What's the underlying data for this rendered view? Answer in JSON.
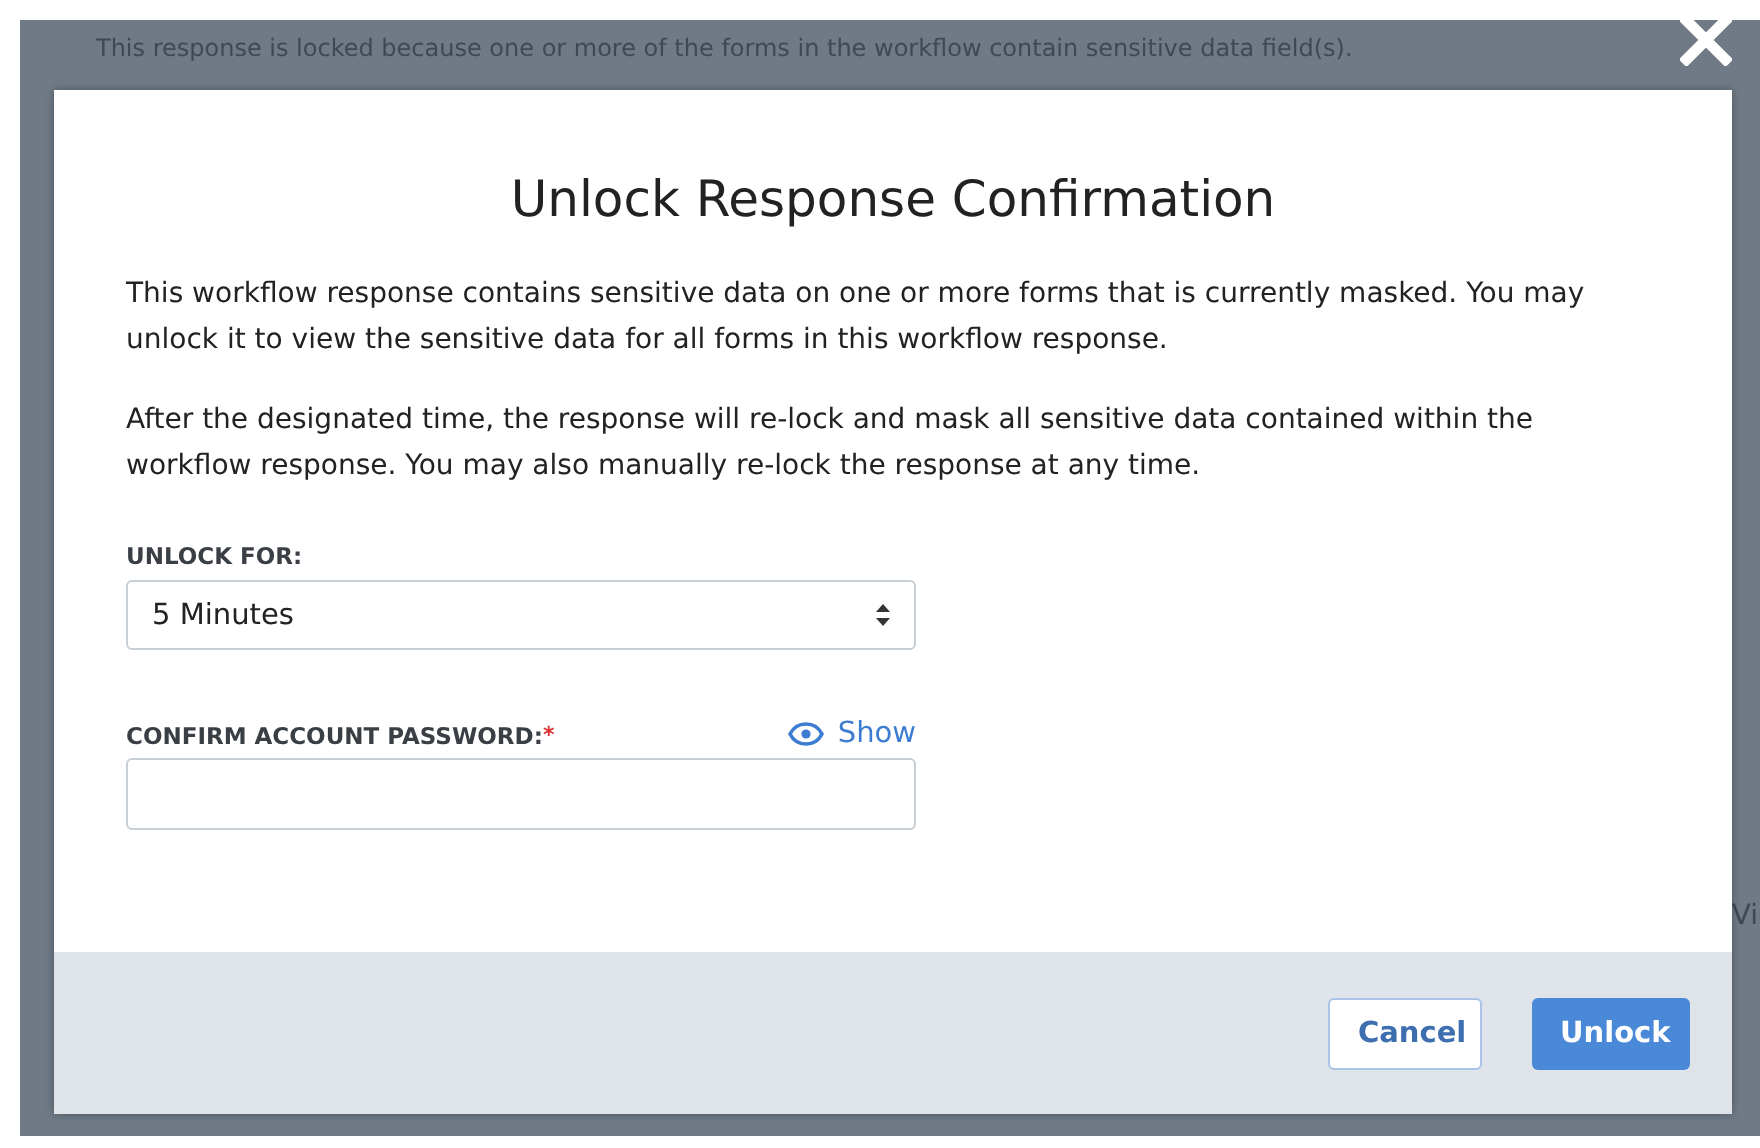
{
  "background_page": {
    "notice": "This response is locked because one or more of the forms in the workflow contain sensitive data field(s).",
    "column_3": "Vi"
  },
  "dialog": {
    "title": "Unlock Response Confirmation",
    "paragraphs": [
      "This workflow response contains sensitive data on one or more forms that is currently masked. You may unlock it to view the sensitive data for all forms in this workflow response.",
      "After the designated time, the response will re-lock and mask all sensitive data contained within the workflow response. You may also manually re-lock the response at any time."
    ],
    "unlock_for": {
      "label": "UNLOCK FOR:",
      "value": "5 Minutes"
    },
    "password": {
      "label": "CONFIRM ACCOUNT PASSWORD:",
      "required": true,
      "required_mark": "*",
      "toggle": "Show"
    },
    "buttons": [
      {
        "label": "Cancel",
        "kind": "secondary"
      },
      {
        "label": "Unlock",
        "kind": "primary"
      }
    ]
  }
}
